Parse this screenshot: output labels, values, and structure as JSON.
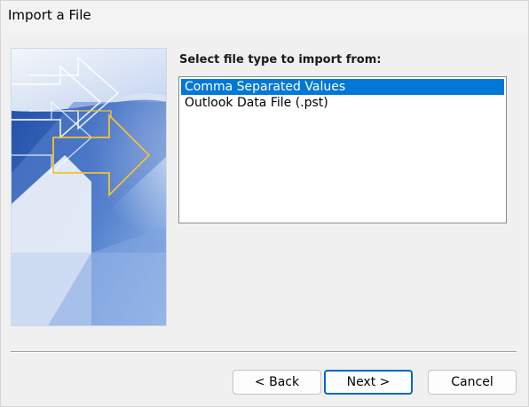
{
  "window": {
    "title": "Import a File"
  },
  "content": {
    "prompt": "Select file type to import from:",
    "file_types": [
      {
        "label": "Comma Separated Values",
        "selected": true
      },
      {
        "label": "Outlook Data File (.pst)",
        "selected": false
      }
    ]
  },
  "buttons": {
    "back_label": "< Back",
    "next_label": "Next >",
    "cancel_label": "Cancel"
  },
  "colors": {
    "selection": "#0078d7",
    "default_button_border": "#0067c0",
    "art_arrow": "#f2c232",
    "art_blue": "#2f5fb3"
  },
  "icons": {
    "wizard_art": "import-wizard-arrows-graphic"
  }
}
